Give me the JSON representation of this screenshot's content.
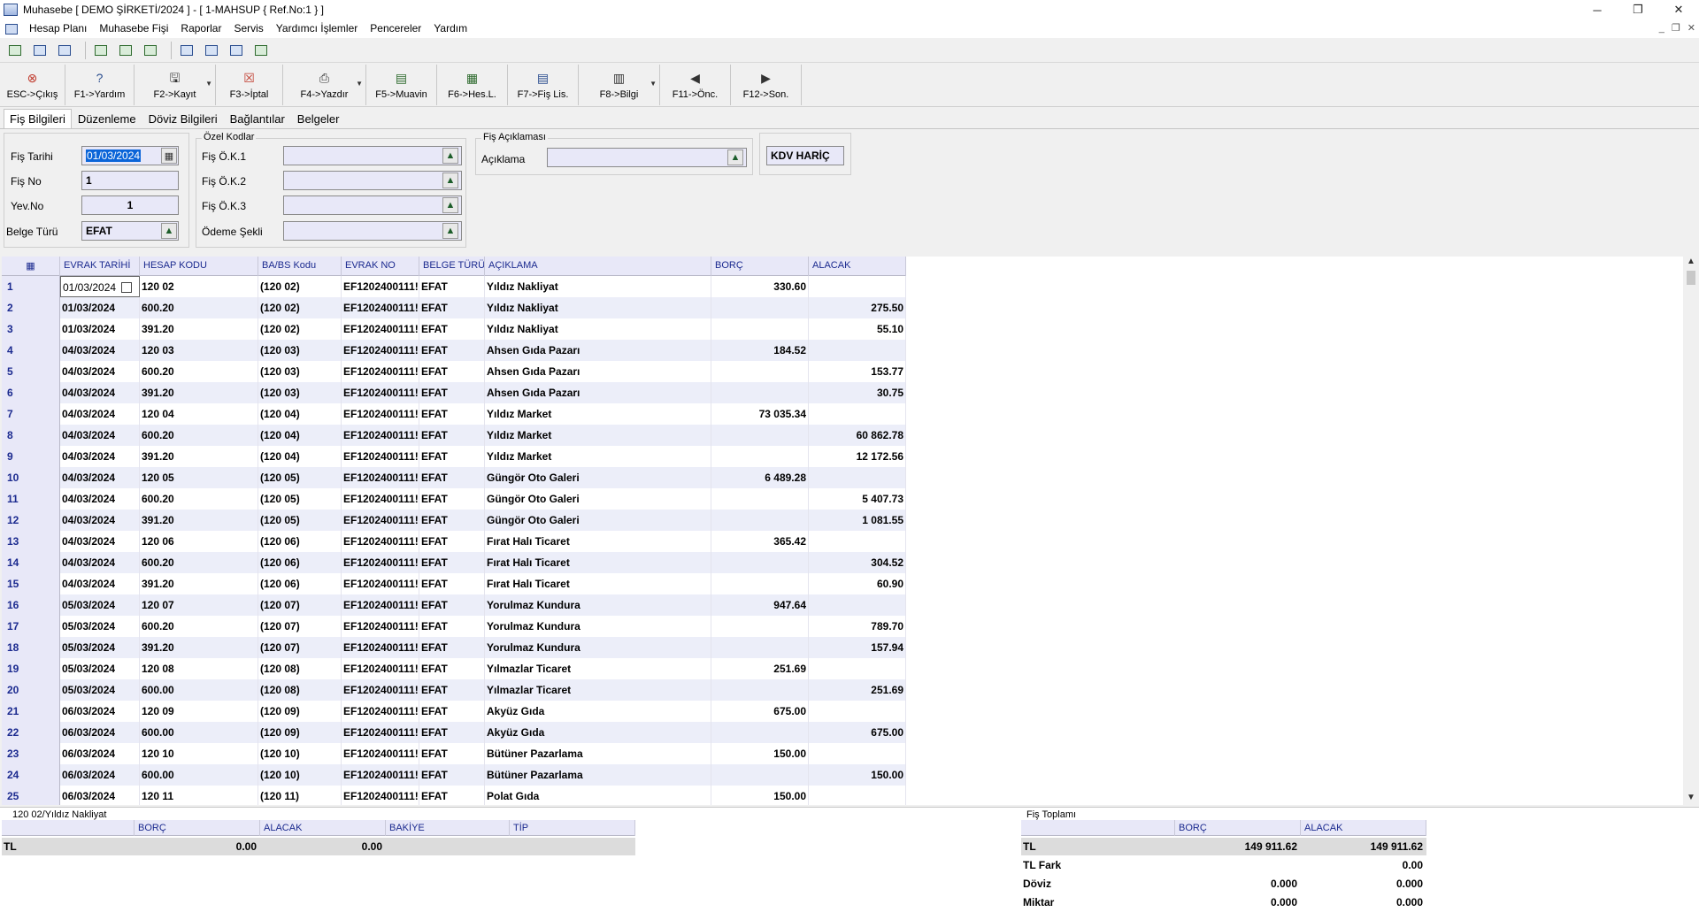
{
  "window": {
    "title": "Muhasebe [ DEMO ŞİRKETİ/2024 ]  - [ 1-MAHSUP { Ref.No:1 } ]",
    "controls": [
      "─",
      "❐",
      "✕"
    ]
  },
  "menu": [
    "Hesap Planı",
    "Muhasebe Fişi",
    "Raporlar",
    "Servis",
    "Yardımcı İşlemler",
    "Pencereler",
    "Yardım"
  ],
  "mdi_controls": [
    "_",
    "❐",
    "✕"
  ],
  "toolbar": [
    {
      "label": "ESC->Çıkış",
      "icon": "⊗"
    },
    {
      "label": "F1->Yardım",
      "icon": "?"
    },
    {
      "label": "F2->Kayıt",
      "icon": "🖫"
    },
    {
      "label": "F3->İptal",
      "icon": "☒"
    },
    {
      "label": "F4->Yazdır",
      "icon": "⎙"
    },
    {
      "label": "F5->Muavin",
      "icon": "▤"
    },
    {
      "label": "F6->Hes.L.",
      "icon": "▦"
    },
    {
      "label": "F7->Fiş Lis.",
      "icon": "▤"
    },
    {
      "label": "F8->Bilgi",
      "icon": "▥"
    },
    {
      "label": "F11->Önc.",
      "icon": "◀"
    },
    {
      "label": "F12->Son.",
      "icon": "▶"
    }
  ],
  "tabs": [
    "Fiş Bilgileri",
    "Düzenleme",
    "Döviz Bilgileri",
    "Bağlantılar",
    "Belgeler"
  ],
  "form": {
    "fis_tarihi_label": "Fiş Tarihi",
    "fis_tarihi": "01/03/2024",
    "fis_no_label": "Fiş No",
    "fis_no": "1",
    "yev_no_label": "Yev.No",
    "yev_no": "1",
    "belge_turu_label": "Belge Türü",
    "belge_turu": "EFAT",
    "ozel_kodlar_title": "Özel Kodlar",
    "ok1_label": "Fiş Ö.K.1",
    "ok2_label": "Fiş Ö.K.2",
    "ok3_label": "Fiş Ö.K.3",
    "odeme_label": "Ödeme Şekli",
    "aciklama_title": "Fiş Açıklaması",
    "aciklama_label": "Açıklama",
    "kdv": "KDV HARİÇ"
  },
  "grid": {
    "columns": [
      "",
      "EVRAK TARİHİ",
      "HESAP KODU",
      "BA/BS Kodu",
      "EVRAK NO",
      "BELGE TÜRÜ",
      "AÇIKLAMA",
      "BORÇ",
      "ALACAK"
    ],
    "rows": [
      [
        "1",
        "01/03/2024",
        "120 02",
        "(120 02)",
        "EF1202400111!",
        "EFAT",
        "Yıldız Nakliyat",
        "330.60",
        ""
      ],
      [
        "2",
        "01/03/2024",
        "600.20",
        "(120 02)",
        "EF1202400111!",
        "EFAT",
        "Yıldız Nakliyat",
        "",
        "275.50"
      ],
      [
        "3",
        "01/03/2024",
        "391.20",
        "(120 02)",
        "EF1202400111!",
        "EFAT",
        "Yıldız Nakliyat",
        "",
        "55.10"
      ],
      [
        "4",
        "04/03/2024",
        "120 03",
        "(120 03)",
        "EF1202400111!",
        "EFAT",
        "Ahsen Gıda Pazarı",
        "184.52",
        ""
      ],
      [
        "5",
        "04/03/2024",
        "600.20",
        "(120 03)",
        "EF1202400111!",
        "EFAT",
        "Ahsen Gıda Pazarı",
        "",
        "153.77"
      ],
      [
        "6",
        "04/03/2024",
        "391.20",
        "(120 03)",
        "EF1202400111!",
        "EFAT",
        "Ahsen Gıda Pazarı",
        "",
        "30.75"
      ],
      [
        "7",
        "04/03/2024",
        "120 04",
        "(120 04)",
        "EF1202400111!",
        "EFAT",
        "Yıldız Market",
        "73 035.34",
        ""
      ],
      [
        "8",
        "04/03/2024",
        "600.20",
        "(120 04)",
        "EF1202400111!",
        "EFAT",
        "Yıldız Market",
        "",
        "60 862.78"
      ],
      [
        "9",
        "04/03/2024",
        "391.20",
        "(120 04)",
        "EF1202400111!",
        "EFAT",
        "Yıldız Market",
        "",
        "12 172.56"
      ],
      [
        "10",
        "04/03/2024",
        "120 05",
        "(120 05)",
        "EF1202400111!",
        "EFAT",
        "Güngör Oto Galeri",
        "6 489.28",
        ""
      ],
      [
        "11",
        "04/03/2024",
        "600.20",
        "(120 05)",
        "EF1202400111!",
        "EFAT",
        "Güngör Oto Galeri",
        "",
        "5 407.73"
      ],
      [
        "12",
        "04/03/2024",
        "391.20",
        "(120 05)",
        "EF1202400111!",
        "EFAT",
        "Güngör Oto Galeri",
        "",
        "1 081.55"
      ],
      [
        "13",
        "04/03/2024",
        "120 06",
        "(120 06)",
        "EF1202400111!",
        "EFAT",
        "Fırat Halı Ticaret",
        "365.42",
        ""
      ],
      [
        "14",
        "04/03/2024",
        "600.20",
        "(120 06)",
        "EF1202400111!",
        "EFAT",
        "Fırat Halı Ticaret",
        "",
        "304.52"
      ],
      [
        "15",
        "04/03/2024",
        "391.20",
        "(120 06)",
        "EF1202400111!",
        "EFAT",
        "Fırat Halı Ticaret",
        "",
        "60.90"
      ],
      [
        "16",
        "05/03/2024",
        "120 07",
        "(120 07)",
        "EF1202400111!",
        "EFAT",
        "Yorulmaz Kundura",
        "947.64",
        ""
      ],
      [
        "17",
        "05/03/2024",
        "600.20",
        "(120 07)",
        "EF1202400111!",
        "EFAT",
        "Yorulmaz Kundura",
        "",
        "789.70"
      ],
      [
        "18",
        "05/03/2024",
        "391.20",
        "(120 07)",
        "EF1202400111!",
        "EFAT",
        "Yorulmaz Kundura",
        "",
        "157.94"
      ],
      [
        "19",
        "05/03/2024",
        "120 08",
        "(120 08)",
        "EF1202400111!",
        "EFAT",
        "Yılmazlar Ticaret",
        "251.69",
        ""
      ],
      [
        "20",
        "05/03/2024",
        "600.00",
        "(120 08)",
        "EF1202400111!",
        "EFAT",
        "Yılmazlar Ticaret",
        "",
        "251.69"
      ],
      [
        "21",
        "06/03/2024",
        "120 09",
        "(120 09)",
        "EF1202400111!",
        "EFAT",
        "Akyüz Gıda",
        "675.00",
        ""
      ],
      [
        "22",
        "06/03/2024",
        "600.00",
        "(120 09)",
        "EF1202400111!",
        "EFAT",
        "Akyüz Gıda",
        "",
        "675.00"
      ],
      [
        "23",
        "06/03/2024",
        "120 10",
        "(120 10)",
        "EF1202400111!",
        "EFAT",
        "Bütüner Pazarlama",
        "150.00",
        ""
      ],
      [
        "24",
        "06/03/2024",
        "600.00",
        "(120 10)",
        "EF1202400111!",
        "EFAT",
        "Bütüner Pazarlama",
        "",
        "150.00"
      ],
      [
        "25",
        "06/03/2024",
        "120 11",
        "(120 11)",
        "EF1202400111!",
        "EFAT",
        "Polat Gıda",
        "150.00",
        ""
      ]
    ]
  },
  "account_summary": {
    "title": "120 02/Yıldız Nakliyat",
    "columns": [
      "BORÇ",
      "ALACAK",
      "BAKİYE",
      "TİP"
    ],
    "row_label": "TL",
    "borc": "0.00",
    "alacak": "0.00"
  },
  "fis_toplami": {
    "title": "Fiş Toplamı",
    "columns": [
      "BORÇ",
      "ALACAK"
    ],
    "rows": [
      {
        "label": "TL",
        "borc": "149 911.62",
        "alacak": "149 911.62"
      },
      {
        "label": "TL Fark",
        "borc": "",
        "alacak": "0.00"
      },
      {
        "label": "Döviz",
        "borc": "0.000",
        "alacak": "0.000"
      },
      {
        "label": "Miktar",
        "borc": "0.000",
        "alacak": "0.000"
      }
    ]
  }
}
